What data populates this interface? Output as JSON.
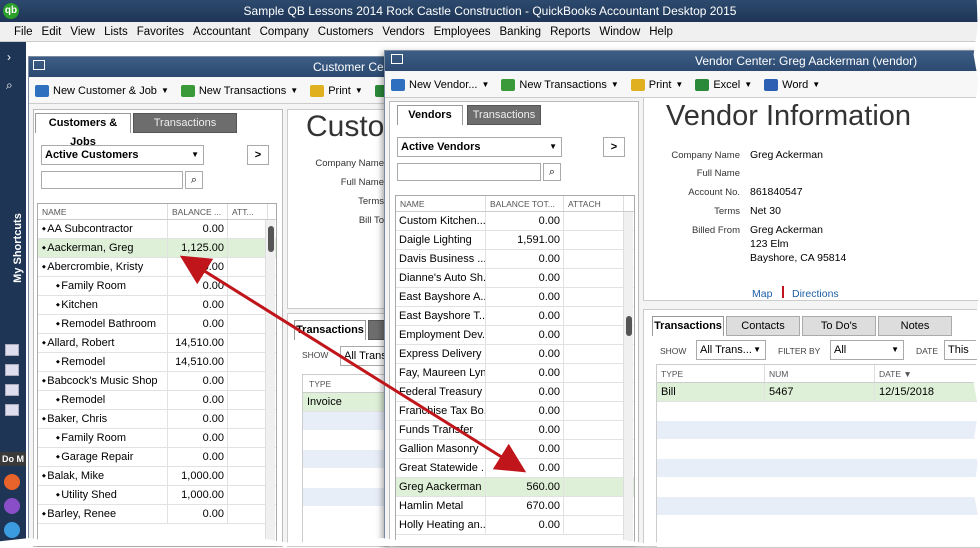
{
  "app": {
    "title": "Sample QB Lessons 2014 Rock Castle Construction  - QuickBooks Accountant Desktop 2015",
    "icon": "qb"
  },
  "menu": [
    "File",
    "Edit",
    "View",
    "Lists",
    "Favorites",
    "Accountant",
    "Company",
    "Customers",
    "Vendors",
    "Employees",
    "Banking",
    "Reports",
    "Window",
    "Help"
  ],
  "shortcuts": {
    "label": "My Shortcuts",
    "bottom_label": "Do M"
  },
  "customer_center": {
    "title": "Customer Center",
    "toolbar": {
      "new_customer": "New Customer & Job",
      "new_transactions": "New Transactions",
      "print": "Print",
      "excel": "Ex"
    },
    "tabs": {
      "active": "Customers & Jobs",
      "inactive": "Transactions"
    },
    "filter": "Active Customers",
    "expand": ">",
    "columns": [
      "NAME",
      "BALANCE ...",
      "ATT..."
    ],
    "rows": [
      {
        "name": "AA Subcontractor",
        "balance": "0.00",
        "indent": 0
      },
      {
        "name": "Aackerman, Greg",
        "balance": "1,125.00",
        "indent": 0,
        "selected": true
      },
      {
        "name": "Abercrombie, Kristy",
        "balance": "0.00",
        "indent": 0
      },
      {
        "name": "Family Room",
        "balance": "0.00",
        "indent": 1
      },
      {
        "name": "Kitchen",
        "balance": "0.00",
        "indent": 1
      },
      {
        "name": "Remodel Bathroom",
        "balance": "0.00",
        "indent": 1
      },
      {
        "name": "Allard, Robert",
        "balance": "14,510.00",
        "indent": 0
      },
      {
        "name": "Remodel",
        "balance": "14,510.00",
        "indent": 1
      },
      {
        "name": "Babcock's Music Shop",
        "balance": "0.00",
        "indent": 0
      },
      {
        "name": "Remodel",
        "balance": "0.00",
        "indent": 1
      },
      {
        "name": "Baker, Chris",
        "balance": "0.00",
        "indent": 0
      },
      {
        "name": "Family Room",
        "balance": "0.00",
        "indent": 1
      },
      {
        "name": "Garage Repair",
        "balance": "0.00",
        "indent": 1
      },
      {
        "name": "Balak, Mike",
        "balance": "1,000.00",
        "indent": 0
      },
      {
        "name": "Utility Shed",
        "balance": "1,000.00",
        "indent": 1
      },
      {
        "name": "Barley, Renee",
        "balance": "0.00",
        "indent": 0
      }
    ],
    "info_title": "Custo",
    "info_labels": [
      "Company Name",
      "Full Name",
      "Terms",
      "Bill To"
    ],
    "bottom_tabs": {
      "active": "Transactions"
    },
    "show_label": "SHOW",
    "show_value": "All Trans...",
    "type_header": "TYPE",
    "type_rows": [
      "Invoice"
    ]
  },
  "vendor_center": {
    "title": "Vendor Center: Greg Aackerman (vendor)",
    "toolbar": {
      "new_vendor": "New Vendor...",
      "new_transactions": "New Transactions",
      "print": "Print",
      "excel": "Excel",
      "word": "Word"
    },
    "tabs": {
      "active": "Vendors",
      "inactive": "Transactions"
    },
    "filter": "Active Vendors",
    "expand": ">",
    "columns": [
      "NAME",
      "BALANCE TOT...",
      "ATTACH"
    ],
    "rows": [
      {
        "name": "Custom Kitchen...",
        "balance": "0.00"
      },
      {
        "name": "Daigle Lighting",
        "balance": "1,591.00"
      },
      {
        "name": "Davis Business ...",
        "balance": "0.00"
      },
      {
        "name": "Dianne's Auto Sh...",
        "balance": "0.00"
      },
      {
        "name": "East Bayshore A...",
        "balance": "0.00"
      },
      {
        "name": "East Bayshore T...",
        "balance": "0.00"
      },
      {
        "name": "Employment Dev...",
        "balance": "0.00"
      },
      {
        "name": "Express Delivery ...",
        "balance": "0.00"
      },
      {
        "name": "Fay, Maureen Lyn...",
        "balance": "0.00"
      },
      {
        "name": "Federal Treasury",
        "balance": "0.00"
      },
      {
        "name": "Franchise Tax Bo...",
        "balance": "0.00"
      },
      {
        "name": "Funds Transfer",
        "balance": "0.00"
      },
      {
        "name": "Gallion Masonry",
        "balance": "0.00"
      },
      {
        "name": "Great Statewide ...",
        "balance": "0.00"
      },
      {
        "name": "Greg Aackerman ...",
        "balance": "560.00",
        "selected": true
      },
      {
        "name": "Hamlin Metal",
        "balance": "670.00"
      },
      {
        "name": "Holly Heating an...",
        "balance": "0.00"
      }
    ],
    "info": {
      "heading": "Vendor Information",
      "company_name_label": "Company Name",
      "company_name": "Greg Ackerman",
      "full_name_label": "Full Name",
      "full_name": "",
      "account_no_label": "Account No.",
      "account_no": "861840547",
      "terms_label": "Terms",
      "terms": "Net 30",
      "billed_from_label": "Billed From",
      "billed_from_1": "Greg Ackerman",
      "billed_from_2": "123 Elm",
      "billed_from_3": "Bayshore, CA 95814",
      "map": "Map",
      "directions": "Directions"
    },
    "detail_tabs": [
      "Transactions",
      "Contacts",
      "To Do's",
      "Notes"
    ],
    "show_label": "SHOW",
    "show_value": "All Trans...",
    "filter_by_label": "FILTER BY",
    "filter_by_value": "All",
    "date_label": "DATE",
    "date_value": "This",
    "tx_columns": [
      "TYPE",
      "NUM",
      "DATE"
    ],
    "tx_rows": [
      {
        "type": "Bill",
        "num": "5467",
        "date": "12/15/2018"
      }
    ]
  },
  "colors": {
    "title_bar": "#2c4a70",
    "selected_row": "#dff0d8",
    "arrow": "#c0151b",
    "link": "#1f5fa8"
  }
}
